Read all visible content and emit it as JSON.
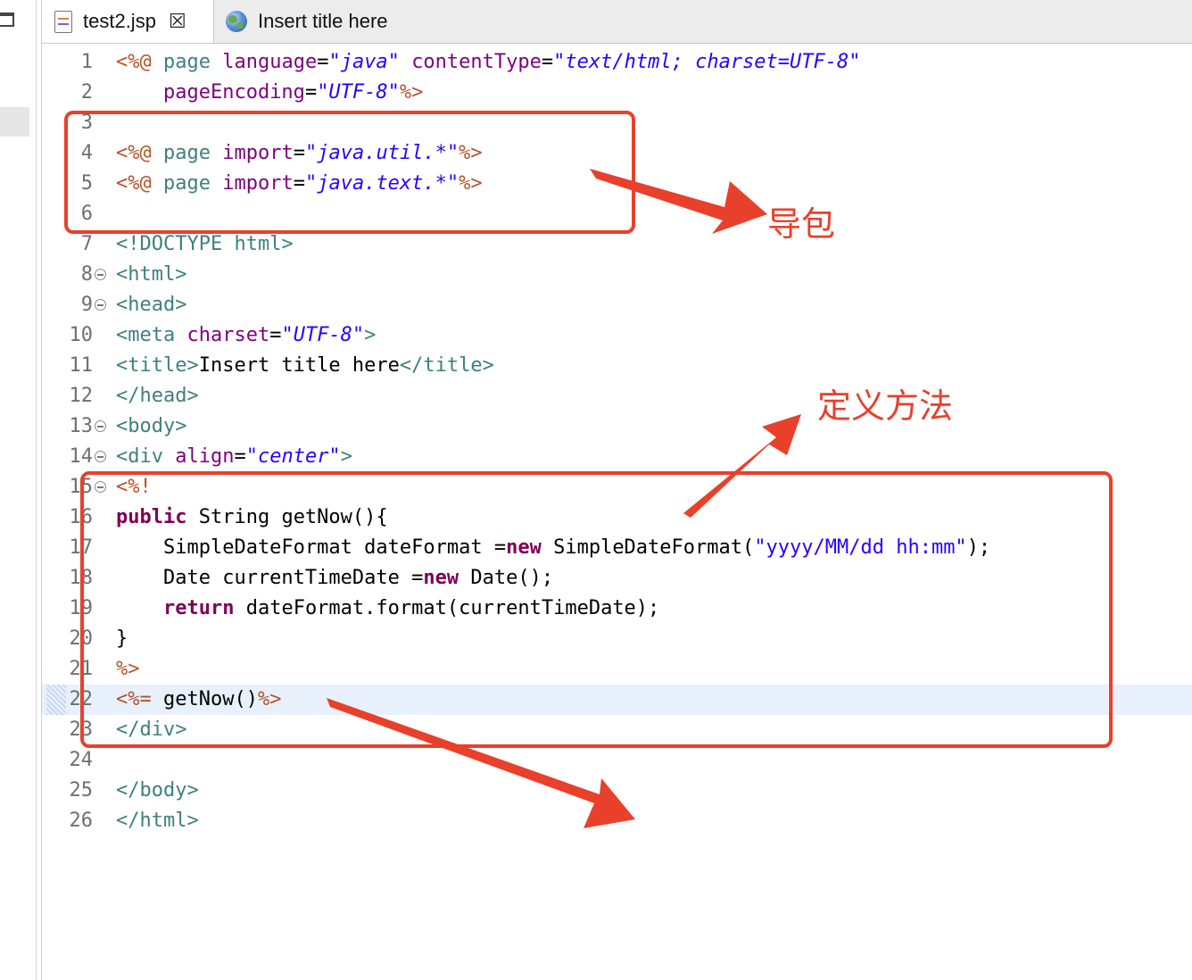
{
  "tabs": [
    {
      "label": "test2.jsp",
      "icon": "jsp-file-icon",
      "close_icon": "close-icon",
      "active": true
    },
    {
      "label": "Insert title here",
      "icon": "globe-icon",
      "active": false
    }
  ],
  "editor": {
    "current_line": 22,
    "lines": [
      {
        "n": "1",
        "segs": [
          [
            "d",
            "<%@"
          ],
          [
            "p",
            " "
          ],
          [
            "t",
            "page"
          ],
          [
            "p",
            " "
          ],
          [
            "a",
            "language"
          ],
          [
            "p",
            "="
          ],
          [
            "s",
            "\"java\""
          ],
          [
            "p",
            " "
          ],
          [
            "a",
            "contentType"
          ],
          [
            "p",
            "="
          ],
          [
            "s",
            "\"text/html; charset=UTF-8\""
          ]
        ]
      },
      {
        "n": "2",
        "segs": [
          [
            "p",
            "    "
          ],
          [
            "a",
            "pageEncoding"
          ],
          [
            "p",
            "="
          ],
          [
            "s",
            "\"UTF-8\""
          ],
          [
            "d",
            "%>"
          ]
        ]
      },
      {
        "n": "3",
        "segs": []
      },
      {
        "n": "4",
        "segs": [
          [
            "d",
            "<%@"
          ],
          [
            "p",
            " "
          ],
          [
            "t",
            "page"
          ],
          [
            "p",
            " "
          ],
          [
            "a",
            "import"
          ],
          [
            "p",
            "="
          ],
          [
            "s",
            "\"java.util.*\""
          ],
          [
            "d",
            "%>"
          ]
        ]
      },
      {
        "n": "5",
        "segs": [
          [
            "d",
            "<%@"
          ],
          [
            "p",
            " "
          ],
          [
            "t",
            "page"
          ],
          [
            "p",
            " "
          ],
          [
            "a",
            "import"
          ],
          [
            "p",
            "="
          ],
          [
            "s",
            "\"java.text.*\""
          ],
          [
            "d",
            "%>"
          ]
        ]
      },
      {
        "n": "6",
        "segs": []
      },
      {
        "n": "7",
        "segs": [
          [
            "t",
            "<!DOCTYPE html>"
          ]
        ]
      },
      {
        "n": "8",
        "fold": true,
        "segs": [
          [
            "t",
            "<html>"
          ]
        ]
      },
      {
        "n": "9",
        "fold": true,
        "segs": [
          [
            "t",
            "<head>"
          ]
        ]
      },
      {
        "n": "10",
        "segs": [
          [
            "t",
            "<meta"
          ],
          [
            "p",
            " "
          ],
          [
            "a",
            "charset"
          ],
          [
            "p",
            "="
          ],
          [
            "s",
            "\"UTF-8\""
          ],
          [
            "t",
            ">"
          ]
        ]
      },
      {
        "n": "11",
        "segs": [
          [
            "t",
            "<title>"
          ],
          [
            "p",
            "Insert title here"
          ],
          [
            "t",
            "</title>"
          ]
        ]
      },
      {
        "n": "12",
        "segs": [
          [
            "t",
            "</head>"
          ]
        ]
      },
      {
        "n": "13",
        "fold": true,
        "segs": [
          [
            "t",
            "<body>"
          ]
        ]
      },
      {
        "n": "14",
        "fold": true,
        "segs": [
          [
            "t",
            "<div"
          ],
          [
            "p",
            " "
          ],
          [
            "a",
            "align"
          ],
          [
            "p",
            "="
          ],
          [
            "s",
            "\"center\""
          ],
          [
            "t",
            ">"
          ]
        ]
      },
      {
        "n": "15",
        "fold": true,
        "segs": [
          [
            "d",
            "<%!"
          ]
        ]
      },
      {
        "n": "16",
        "segs": [
          [
            "k",
            "public"
          ],
          [
            "p",
            " String getNow(){"
          ]
        ]
      },
      {
        "n": "17",
        "segs": [
          [
            "p",
            "    SimpleDateFormat dateFormat ="
          ],
          [
            "k",
            "new"
          ],
          [
            "p",
            " SimpleDateFormat("
          ],
          [
            "js",
            "\"yyyy/MM/dd hh:mm\""
          ],
          [
            "p",
            ");"
          ]
        ]
      },
      {
        "n": "18",
        "segs": [
          [
            "p",
            "    Date currentTimeDate ="
          ],
          [
            "k",
            "new"
          ],
          [
            "p",
            " Date();"
          ]
        ]
      },
      {
        "n": "19",
        "segs": [
          [
            "p",
            "    "
          ],
          [
            "k",
            "return"
          ],
          [
            "p",
            " dateFormat.format(currentTimeDate);"
          ]
        ]
      },
      {
        "n": "20",
        "segs": [
          [
            "p",
            "}"
          ]
        ]
      },
      {
        "n": "21",
        "segs": [
          [
            "d",
            "%>"
          ]
        ]
      },
      {
        "n": "22",
        "segs": [
          [
            "d",
            "<%="
          ],
          [
            "p",
            " getNow()"
          ],
          [
            "d",
            "%>"
          ]
        ]
      },
      {
        "n": "23",
        "segs": [
          [
            "t",
            "</div>"
          ]
        ]
      },
      {
        "n": "24",
        "segs": []
      },
      {
        "n": "25",
        "segs": [
          [
            "t",
            "</body>"
          ]
        ]
      },
      {
        "n": "26",
        "segs": [
          [
            "t",
            "</html>"
          ]
        ]
      }
    ]
  },
  "annotations": {
    "import_label": "导包",
    "method_label": "定义方法",
    "color": "#e8402b"
  }
}
